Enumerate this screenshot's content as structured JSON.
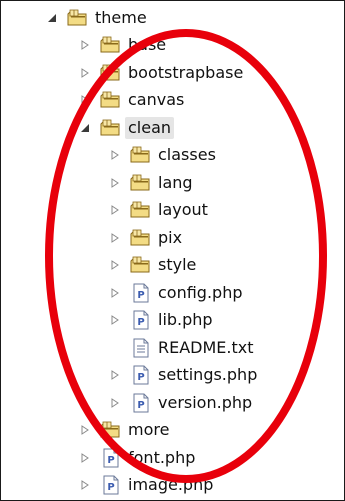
{
  "tree": {
    "root": {
      "label": "theme",
      "expanded": true,
      "icon": "package-folder-icon"
    },
    "level1_before": [
      {
        "label": "base",
        "icon": "package-folder-icon"
      },
      {
        "label": "bootstrapbase",
        "icon": "package-folder-icon"
      },
      {
        "label": "canvas",
        "icon": "package-folder-icon"
      }
    ],
    "clean": {
      "label": "clean",
      "expanded": true,
      "icon": "package-folder-icon"
    },
    "clean_children": [
      {
        "label": "classes",
        "icon": "package-folder-icon",
        "expandable": true
      },
      {
        "label": "lang",
        "icon": "package-folder-icon",
        "expandable": true
      },
      {
        "label": "layout",
        "icon": "package-folder-icon",
        "expandable": true
      },
      {
        "label": "pix",
        "icon": "package-folder-icon",
        "expandable": true
      },
      {
        "label": "style",
        "icon": "package-folder-icon",
        "expandable": true
      },
      {
        "label": "config.php",
        "icon": "php-file-icon",
        "expandable": true
      },
      {
        "label": "lib.php",
        "icon": "php-file-icon",
        "expandable": true
      },
      {
        "label": "README.txt",
        "icon": "text-file-icon",
        "expandable": false
      },
      {
        "label": "settings.php",
        "icon": "php-file-icon",
        "expandable": true
      },
      {
        "label": "version.php",
        "icon": "php-file-icon",
        "expandable": true
      }
    ],
    "level1_after": [
      {
        "label": "more",
        "icon": "package-folder-icon",
        "expandable": true
      },
      {
        "label": "font.php",
        "icon": "php-file-icon",
        "expandable": true
      },
      {
        "label": "image.php",
        "icon": "php-file-icon",
        "expandable": true
      }
    ]
  },
  "colors": {
    "highlight_oval": "#e8000b",
    "folder_fill": "#f3dc85",
    "folder_stroke": "#8a6a1a",
    "php_badge": "#3b5cb0"
  }
}
